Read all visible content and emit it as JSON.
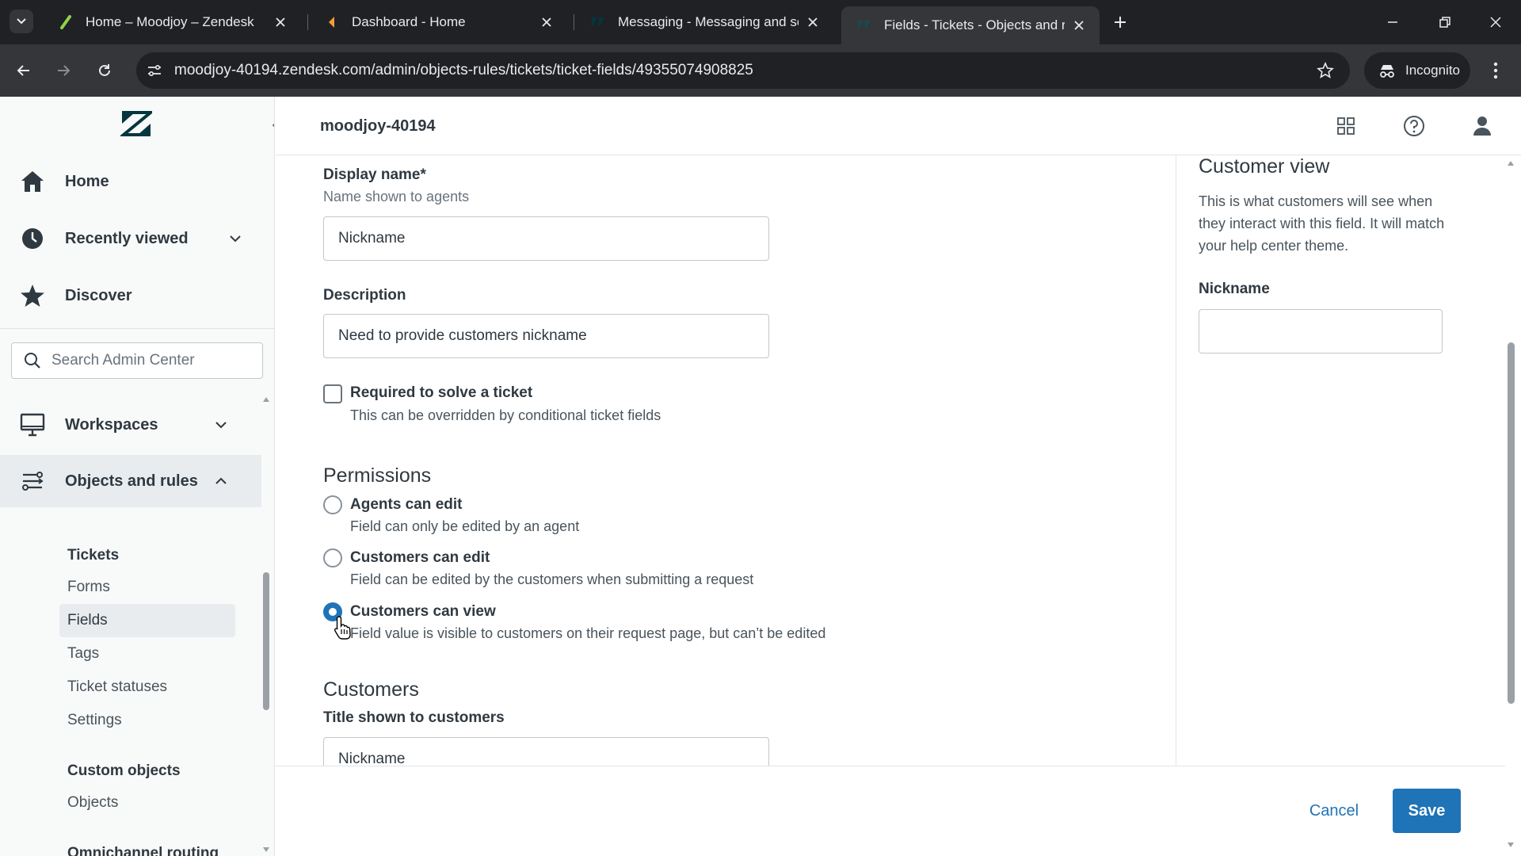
{
  "browser": {
    "tabs": [
      {
        "title": "Home – Moodjoy – Zendesk",
        "favicon": "zendesk-support-icon",
        "active": false
      },
      {
        "title": "Dashboard - Home",
        "favicon": "dashboard-icon",
        "active": false
      },
      {
        "title": "Messaging - Messaging and so",
        "favicon": "zendesk-icon",
        "active": false
      },
      {
        "title": "Fields - Tickets - Objects and ru",
        "favicon": "zendesk-icon",
        "active": true
      }
    ],
    "url": "moodjoy-40194.zendesk.com/admin/objects-rules/tickets/ticket-fields/49355074908825",
    "incognito_label": "Incognito"
  },
  "sidebar": {
    "nav": [
      {
        "label": "Home",
        "icon": "home-icon"
      },
      {
        "label": "Recently viewed",
        "icon": "clock-icon"
      },
      {
        "label": "Discover",
        "icon": "star-icon"
      }
    ],
    "search_placeholder": "Search Admin Center",
    "sections": [
      {
        "label": "Workspaces",
        "icon": "monitor-icon"
      },
      {
        "label": "Objects and rules",
        "icon": "objects-rules-icon"
      }
    ],
    "tickets_heading": "Tickets",
    "ticket_items": [
      "Forms",
      "Fields",
      "Tags",
      "Ticket statuses",
      "Settings"
    ],
    "active_item": "Fields",
    "custom_objects_heading": "Custom objects",
    "custom_object_items": [
      "Objects"
    ],
    "next_heading": "Omnichannel routing"
  },
  "header": {
    "subdomain": "moodjoy-40194"
  },
  "form": {
    "display_name": {
      "label": "Display name*",
      "hint": "Name shown to agents",
      "value": "Nickname"
    },
    "description": {
      "label": "Description",
      "value": "Need to provide customers nickname"
    },
    "required": {
      "label": "Required to solve a ticket",
      "hint": "This can be overridden by conditional ticket fields",
      "checked": false
    },
    "permissions": {
      "title": "Permissions",
      "options": [
        {
          "label": "Agents can edit",
          "hint": "Field can only be edited by an agent",
          "checked": false
        },
        {
          "label": "Customers can edit",
          "hint": "Field can be edited by the customers when submitting a request",
          "checked": false
        },
        {
          "label": "Customers can view",
          "hint": "Field value is visible to customers on their request page, but can’t be edited",
          "checked": true
        }
      ]
    },
    "customers": {
      "title": "Customers",
      "title_label": "Title shown to customers",
      "title_value": "Nickname"
    }
  },
  "preview": {
    "title": "Customer view",
    "text": "This is what customers will see when they interact with this field. It will match your help center theme.",
    "field_label": "Nickname"
  },
  "footer": {
    "cancel_label": "Cancel",
    "save_label": "Save"
  },
  "colors": {
    "accent": "#1f73b7",
    "chrome_dark": "#202124",
    "chrome_mid": "#35363a"
  }
}
